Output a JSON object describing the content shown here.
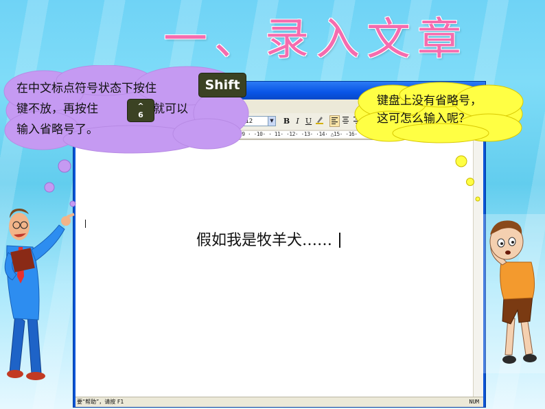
{
  "slide": {
    "title": "一、录入文章"
  },
  "word": {
    "font_name": "宋体_GB2312",
    "font_box_display": "ESE_GB2312",
    "toolbar_buttons": [
      "B",
      "I",
      "U",
      "A"
    ],
    "ruler_text": "· 5 · · 6 · · 7 · · 8 · · 9 · ·10· · 11· ·12· ·13· ·14· △15· ·16· ·17· ·",
    "document_text": "假如我是牧羊犬……",
    "status_left": "要“帮助”，请按 F1",
    "status_right": "NUM"
  },
  "bubble_left": {
    "line1": "在中文标点符号状态下按住",
    "line2_pre": "键不放，再按住",
    "line2_post": "键，就可以",
    "line3": "输入省略号了。",
    "key_shift": "Shift",
    "key_6_top": "^",
    "key_6_bottom": "6"
  },
  "bubble_right": {
    "line1": "键盘上没有省略号，",
    "line2": "这可怎么输入呢？"
  },
  "colors": {
    "title": "#f56cae",
    "bubble_left_fill": "#c59af2",
    "bubble_right_fill": "#ffff44",
    "key": "#3b4223",
    "word_frame": "#0a54d6"
  }
}
